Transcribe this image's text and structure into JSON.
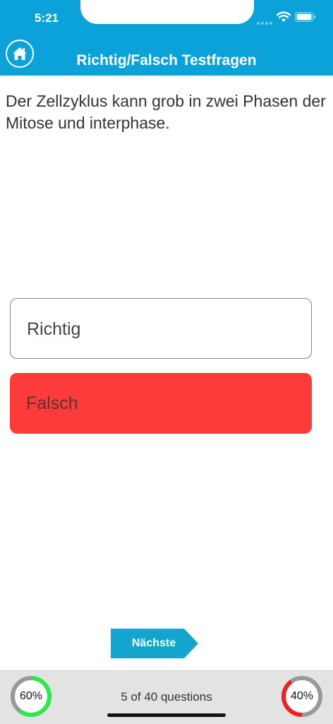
{
  "status_bar": {
    "time": "5:21"
  },
  "header": {
    "title": "Richtig/Falsch Testfragen",
    "home_icon": "home-icon"
  },
  "question": {
    "text": "Der Zellzyklus kann grob in zwei Phasen der Mitose und interphase."
  },
  "answers": [
    {
      "label": "Richtig",
      "state": "unselected"
    },
    {
      "label": "Falsch",
      "state": "selected-wrong"
    }
  ],
  "next_button": {
    "label": "Nächste"
  },
  "footer": {
    "progress_text": "5 of 40 questions",
    "correct_gauge": {
      "label": "60%",
      "value": 0.6,
      "color": "#2ee84c"
    },
    "wrong_gauge": {
      "label": "40%",
      "value": 0.4,
      "color": "#ee2222"
    }
  },
  "colors": {
    "header": "#0aa2d9",
    "wrong_answer": "#fe3b3b",
    "next_button": "#12a6cf"
  }
}
